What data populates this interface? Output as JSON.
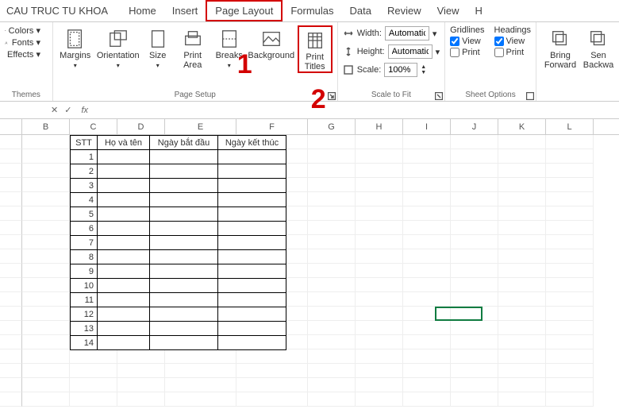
{
  "doc_title": "CAU TRUC TU KHOA",
  "tabs": [
    "Home",
    "Insert",
    "Page Layout",
    "Formulas",
    "Data",
    "Review",
    "View",
    "H"
  ],
  "active_tab": "Page Layout",
  "annotations": {
    "step1": "1",
    "step2": "2"
  },
  "themes": {
    "colors": "Colors",
    "fonts": "Fonts",
    "effects": "Effects",
    "group": "Themes"
  },
  "page_setup": {
    "margins": "Margins",
    "orientation": "Orientation",
    "size": "Size",
    "print_area": "Print\nArea",
    "breaks": "Breaks",
    "background": "Background",
    "print_titles": "Print\nTitles",
    "group": "Page Setup"
  },
  "scale_to_fit": {
    "width_label": "Width:",
    "width_value": "Automatic",
    "height_label": "Height:",
    "height_value": "Automatic",
    "scale_label": "Scale:",
    "scale_value": "100%",
    "group": "Scale to Fit"
  },
  "sheet_options": {
    "gridlines": "Gridlines",
    "headings": "Headings",
    "view": "View",
    "print": "Print",
    "group": "Sheet Options"
  },
  "arrange": {
    "bring_forward": "Bring\nForward",
    "send_backward": "Sen\nBackwa"
  },
  "formula_bar": {
    "fx": "fx"
  },
  "columns": [
    "B",
    "C",
    "D",
    "E",
    "F",
    "G",
    "H",
    "I",
    "J",
    "K",
    "L"
  ],
  "table": {
    "headers": {
      "stt": "STT",
      "name": "Họ và tên",
      "start": "Ngày bắt đầu",
      "end": "Ngày kết thúc"
    },
    "rows": [
      "1",
      "2",
      "3",
      "4",
      "5",
      "6",
      "7",
      "8",
      "9",
      "10",
      "11",
      "12",
      "13",
      "14"
    ]
  },
  "active_cell": "I12"
}
